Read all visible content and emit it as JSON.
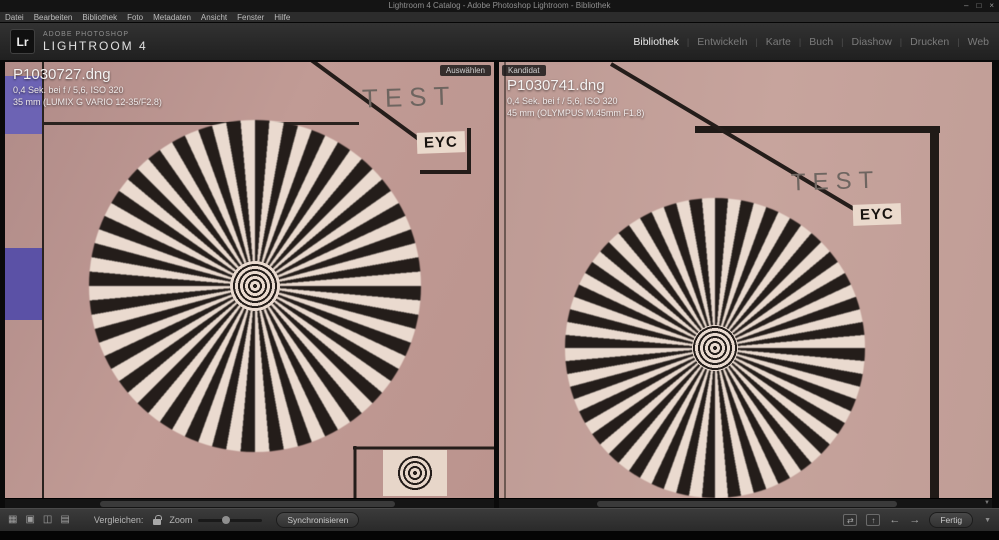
{
  "window": {
    "title": "Lightroom 4 Catalog - Adobe Photoshop Lightroom - Bibliothek",
    "controls": {
      "minimize": "–",
      "maximize": "□",
      "close": "×"
    }
  },
  "menu": {
    "items": [
      "Datei",
      "Bearbeiten",
      "Bibliothek",
      "Foto",
      "Metadaten",
      "Ansicht",
      "Fenster",
      "Hilfe"
    ]
  },
  "header": {
    "logo": "Lr",
    "brand_top": "ADOBE PHOTOSHOP",
    "brand_bottom": "LIGHTROOM 4",
    "modules": [
      "Bibliothek",
      "Entwickeln",
      "Karte",
      "Buch",
      "Diashow",
      "Drucken",
      "Web"
    ],
    "active_module": "Bibliothek"
  },
  "compare": {
    "select": {
      "badge": "Auswählen",
      "filename": "P1030727.dng",
      "line1": "0,4 Sek. bei f / 5,6, ISO 320",
      "line2": "35 mm (LUMIX G VARIO 12-35/F2.8)"
    },
    "candidate": {
      "badge": "Kandidat",
      "filename": "P1030741.dng",
      "line1": "0,4 Sek. bei f / 5,6, ISO 320",
      "line2": "45 mm (OLYMPUS M.45mm F1.8)"
    }
  },
  "chart": {
    "test_text": "TEST",
    "eyc_label": "EYC"
  },
  "toolbar": {
    "compare_label": "Vergleichen:",
    "zoom_label": "Zoom",
    "sync_button": "Synchronisieren",
    "done_button": "Fertig"
  },
  "icons": {
    "grid": "▦",
    "loupe": "▣",
    "compare": "◫",
    "survey": "▤",
    "swap": "⇄",
    "promote": "↑",
    "prev": "←",
    "next": "→",
    "scroll_down": "▼",
    "options_chevron": "▼"
  },
  "colors": {
    "chart_pink_left": "#bd9792",
    "chart_pink_right": "#c4a099",
    "star_dark": "#241d1a",
    "star_light": "#eadacf",
    "purple_square": "#6c63b4",
    "ui_dark": "#2c2c2c"
  }
}
